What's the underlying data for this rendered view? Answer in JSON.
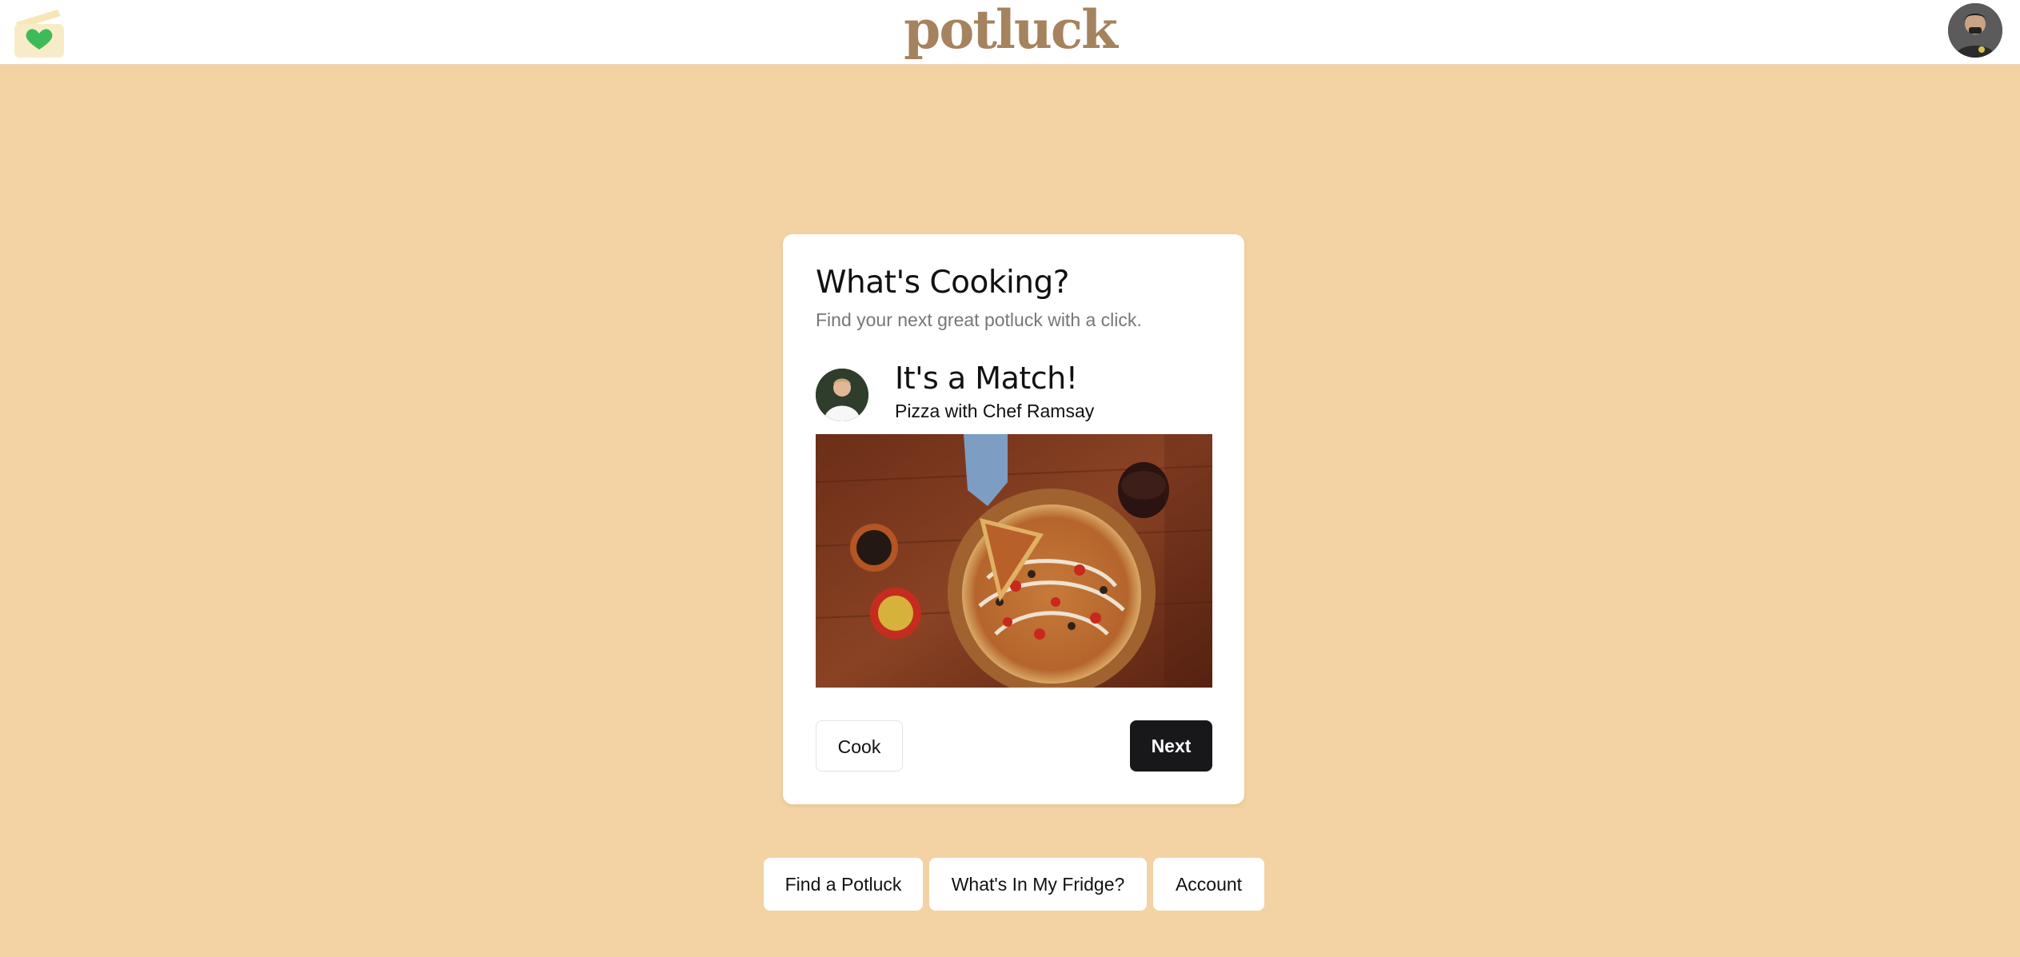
{
  "header": {
    "brand": "potluck",
    "logo_icon": "heart-box-icon",
    "user_avatar": "user-avatar"
  },
  "card": {
    "title": "What's Cooking?",
    "subtitle": "Find your next great potluck with a click.",
    "match": {
      "title": "It's a Match!",
      "subtitle": "Pizza with Chef Ramsay",
      "chef_avatar": "chef-avatar",
      "image": "pizza-photo"
    },
    "actions": {
      "cook_label": "Cook",
      "next_label": "Next"
    }
  },
  "nav": {
    "find_label": "Find a Potluck",
    "fridge_label": "What's In My Fridge?",
    "account_label": "Account"
  },
  "colors": {
    "background": "#f3d3a3",
    "brand": "#a5835e",
    "primary_button": "#18181b",
    "heart": "#3dbb5a"
  }
}
